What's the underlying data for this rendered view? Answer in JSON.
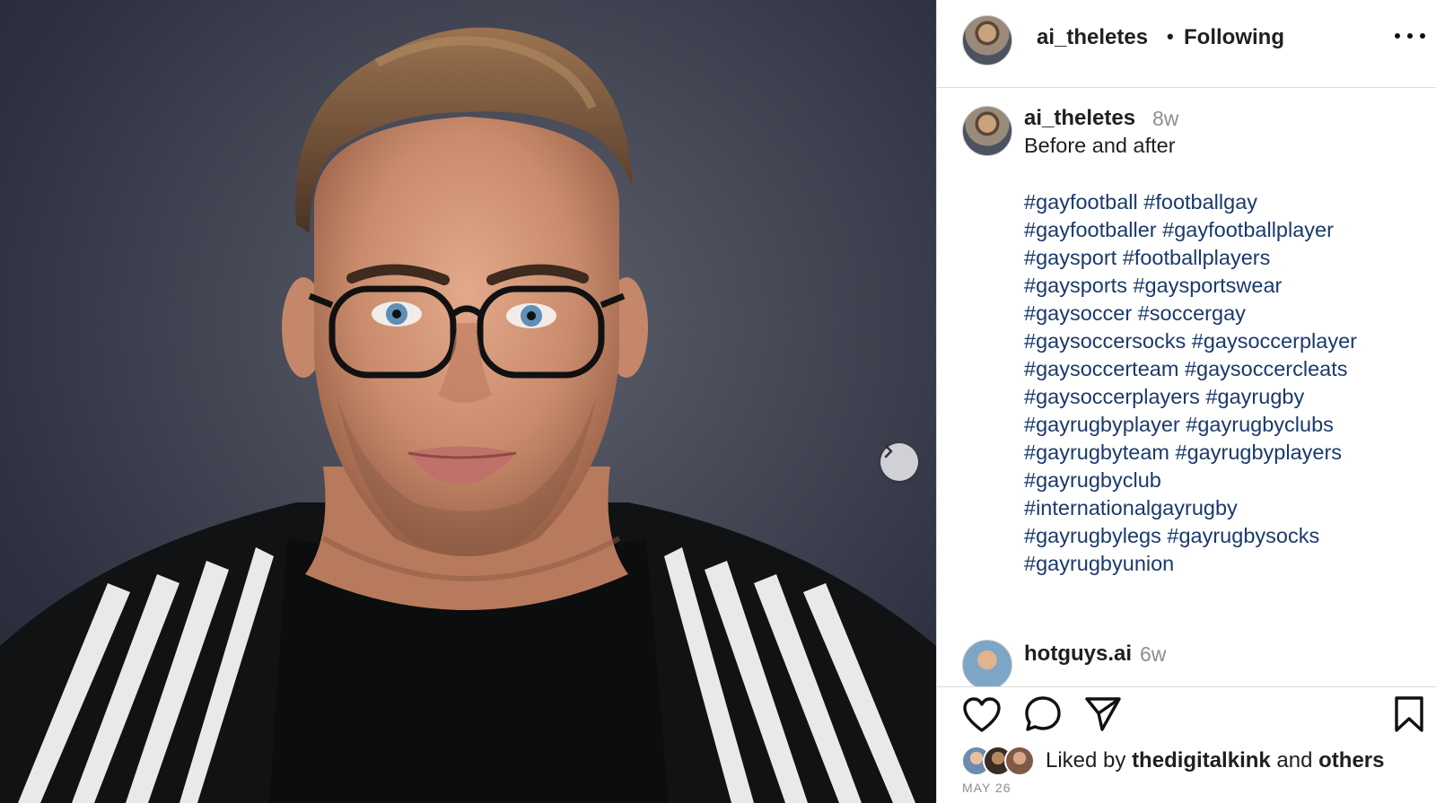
{
  "post": {
    "author": "ai_theletes",
    "separator": "•",
    "follow_status": "Following",
    "caption_author": "ai_theletes",
    "caption_time": "8w",
    "caption_text": "Before and after",
    "hashtag_lines": [
      [
        "#gayfootball",
        "#footballgay"
      ],
      [
        "#gayfootballer",
        "#gayfootballplayer"
      ],
      [
        "#gaysport",
        "#footballplayers"
      ],
      [
        "#gaysports",
        "#gaysportswear"
      ],
      [
        "#gaysoccer",
        "#soccergay"
      ],
      [
        "#gaysoccersocks",
        "#gaysoccerplayer"
      ],
      [
        "#gaysoccerteam",
        "#gaysoccercleats"
      ],
      [
        "#gaysoccerplayers",
        "#gayrugby"
      ],
      [
        "#gayrugbyplayer",
        "#gayrugbyclubs"
      ],
      [
        "#gayrugbyteam",
        "#gayrugbyplayers"
      ],
      [
        "#gayrugbyclub"
      ],
      [
        "#internationalgayrugby"
      ],
      [
        "#gayrugbylegs",
        "#gayrugbysocks"
      ],
      [
        "#gayrugbyunion"
      ]
    ],
    "comment": {
      "author": "hotguys.ai",
      "time": "6w"
    },
    "likes": {
      "prefix": "Liked by",
      "user": "thedigitalkink",
      "middle": "and",
      "suffix": "others"
    },
    "date": "MAY 26"
  },
  "icons": {
    "more": "more-options-icon",
    "next": "chevron-right-icon",
    "like": "heart-icon",
    "comment": "comment-icon",
    "share": "send-icon",
    "save": "bookmark-icon"
  },
  "colors": {
    "hashtag": "#1a3a6b",
    "muted": "#8e8e8e",
    "border": "#dbdbdb"
  }
}
